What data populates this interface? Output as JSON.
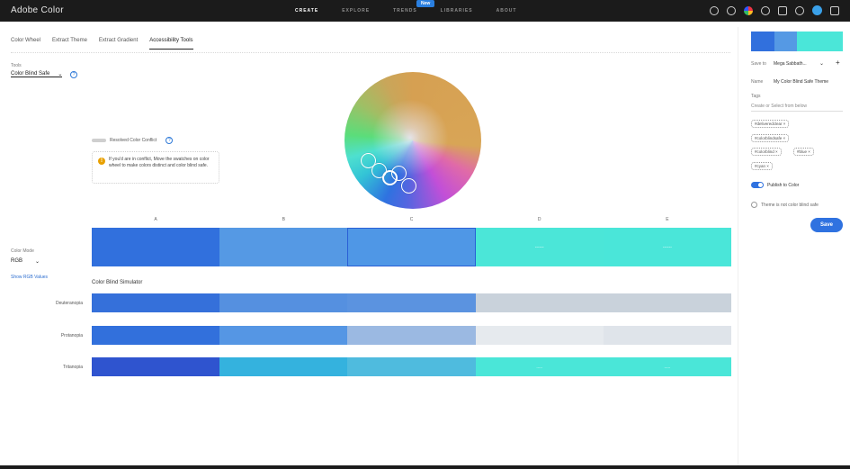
{
  "app": {
    "title": "Adobe Color"
  },
  "topnav": {
    "items": [
      "CREATE",
      "EXPLORE",
      "TRENDS",
      "LIBRARIES",
      "ABOUT"
    ],
    "active": "CREATE",
    "new_badge": "New"
  },
  "tabs": [
    {
      "label": "Color Wheel"
    },
    {
      "label": "Extract Theme"
    },
    {
      "label": "Extract Gradient"
    },
    {
      "label": "Accessibility Tools",
      "active": true
    }
  ],
  "tools": {
    "label": "Tools",
    "selected": "Color Blind Safe"
  },
  "conflict": {
    "title": "Resolved Color Conflict",
    "message": "If you'd are in conflict, Move the swatches on color wheel to make colors distinct and color blind safe."
  },
  "swatches": {
    "letters": [
      "A",
      "B",
      "C",
      "D",
      "E"
    ],
    "colors": [
      "#3170dd",
      "#5599e4",
      "#4f97e6",
      "#4be6d8",
      "#4ae6d9"
    ],
    "values": [
      "",
      "",
      "",
      "------",
      "------"
    ],
    "selected_index": 2
  },
  "color_mode": {
    "label": "Color Mode",
    "selected": "RGB",
    "show_values": "Show RGB Values"
  },
  "simulator": {
    "title": "Color Blind Simulator",
    "rows": [
      {
        "label": "Deuteranopia",
        "colors": [
          "#3570da",
          "#5590e0",
          "#5b93e0",
          "#c9d2db",
          "#c9d2db"
        ],
        "values": [
          "",
          "",
          "",
          "",
          ""
        ]
      },
      {
        "label": "Protanopia",
        "colors": [
          "#3270dc",
          "#5596e4",
          "#9bb9e2",
          "#e6eaee",
          "#dfe4ea"
        ],
        "values": [
          "",
          "",
          "",
          "",
          ""
        ]
      },
      {
        "label": "Tritanopia",
        "colors": [
          "#2f54cf",
          "#34b2de",
          "#4fbbde",
          "#4ae6d8",
          "#4ae6d8"
        ],
        "values": [
          "",
          "",
          "",
          "-----",
          "-----"
        ]
      }
    ]
  },
  "right_panel": {
    "palette": [
      "#3170dd",
      "#5599e4",
      "#4ae6d9",
      "#4be6d8"
    ],
    "save_to_label": "Save to",
    "save_to_value": "Mega Sabbath...",
    "name_label": "Name",
    "name_value": "My Color Blind Safe Theme",
    "tags_label": "Tags",
    "tags_placeholder": "Create or Select from below",
    "tags": [
      "#deliveredclear",
      "#colorblindsafe",
      "#colorblind",
      "#blue",
      "#cyan"
    ],
    "publish_label": "Publish to Color",
    "publish_on": true,
    "status_message": "Theme is not color blind safe",
    "save_button": "Save"
  }
}
